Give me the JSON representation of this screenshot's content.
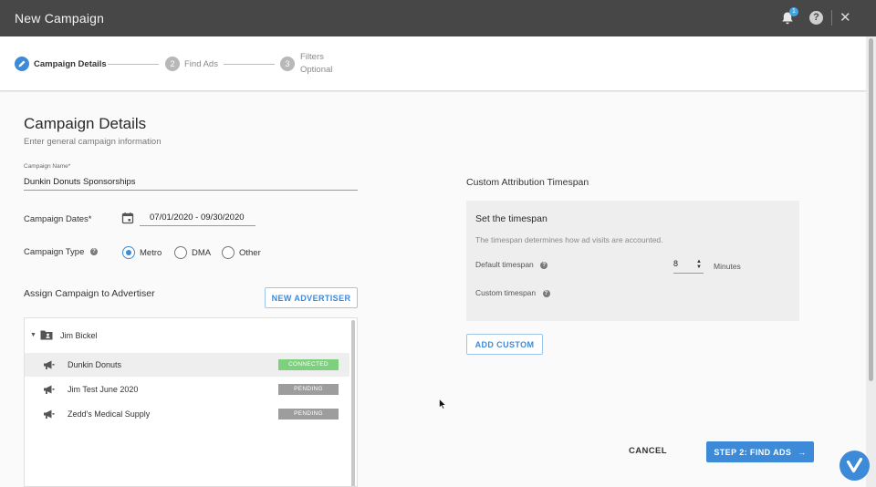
{
  "window": {
    "title": "New Campaign",
    "notification_count": "1",
    "help_symbol": "?",
    "close_symbol": "✕"
  },
  "stepper": {
    "steps": [
      {
        "number": "",
        "label": "Campaign Details",
        "state": "active"
      },
      {
        "number": "2",
        "label": "Find Ads",
        "state": "inactive"
      },
      {
        "number": "3",
        "label": "Filters",
        "sublabel": "Optional",
        "state": "inactive"
      }
    ]
  },
  "form": {
    "heading": "Campaign Details",
    "subheading": "Enter general campaign information",
    "campaign_name_label": "Campaign Name*",
    "campaign_name_value": "Dunkin Donuts Sponsorships",
    "campaign_dates_label": "Campaign Dates*",
    "campaign_dates_value": "07/01/2020 - 09/30/2020",
    "campaign_type_label": "Campaign Type",
    "campaign_type_options": [
      {
        "label": "Metro",
        "selected": true
      },
      {
        "label": "DMA",
        "selected": false
      },
      {
        "label": "Other",
        "selected": false
      }
    ]
  },
  "advertiser": {
    "title": "Assign Campaign to Advertiser",
    "new_button": "NEW ADVERTISER",
    "group": "Jim Bickel",
    "items": [
      {
        "name": "Dunkin Donuts",
        "status": "CONNECTED",
        "selected": true
      },
      {
        "name": "Jim Test June 2020",
        "status": "PENDING",
        "selected": false
      },
      {
        "name": "Zedd's Medical Supply",
        "status": "PENDING",
        "selected": false
      }
    ]
  },
  "attribution": {
    "title": "Custom Attribution Timespan",
    "set_title": "Set the timespan",
    "description": "The timespan determines how ad visits are accounted.",
    "default_label": "Default timespan",
    "default_value": "8",
    "unit": "Minutes",
    "custom_label": "Custom timespan",
    "add_button": "ADD CUSTOM"
  },
  "footer": {
    "cancel": "CANCEL",
    "next": "STEP 2: FIND ADS"
  },
  "colors": {
    "accent": "#3d8ad8",
    "connected": "#7dd07d",
    "pending": "#9d9d9d",
    "topbar": "#474747"
  }
}
